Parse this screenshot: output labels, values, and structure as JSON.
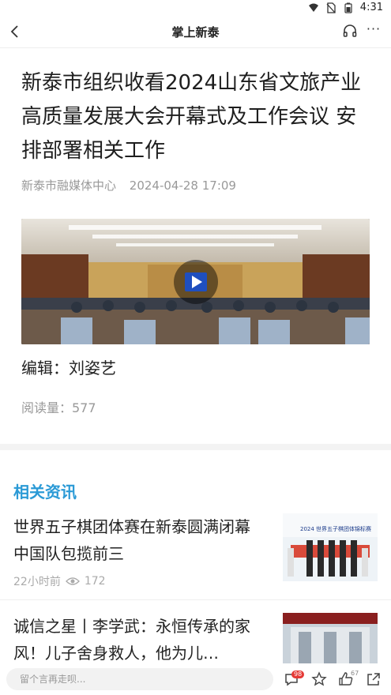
{
  "statusbar": {
    "time": "4:31"
  },
  "navbar": {
    "title": "掌上新泰",
    "more_label": "···"
  },
  "article": {
    "title": "新泰市组织收看2024山东省文旅产业高质量发展大会开幕式及工作会议 安排部署相关工作",
    "source": "新泰市融媒体中心",
    "datetime": "2024-04-28 17:09",
    "editor": "编辑：刘姿艺",
    "reads": "阅读量：577"
  },
  "related": {
    "heading": "相关资讯",
    "items": [
      {
        "title": "世界五子棋团体赛在新泰圆满闭幕 中国队包揽前三",
        "time": "22小时前",
        "views": "172",
        "thumb_caption": "2024 世界五子棋团体锦标赛"
      },
      {
        "title": "诚信之星丨李学武：永恒传承的家风！儿子舍身救人，他为儿…"
      }
    ]
  },
  "bottombar": {
    "comment_placeholder": "留个言再走呗...",
    "comment_badge": "98",
    "like_count": "67"
  },
  "colors": {
    "accent": "#2b9ad6",
    "badge": "#e53935"
  },
  "icons": [
    "wifi-icon",
    "sim-off-icon",
    "battery-icon",
    "back-arrow-icon",
    "headphones-icon",
    "more-icon",
    "play-icon",
    "eye-icon",
    "comment-icon",
    "star-icon",
    "like-icon",
    "share-icon"
  ]
}
